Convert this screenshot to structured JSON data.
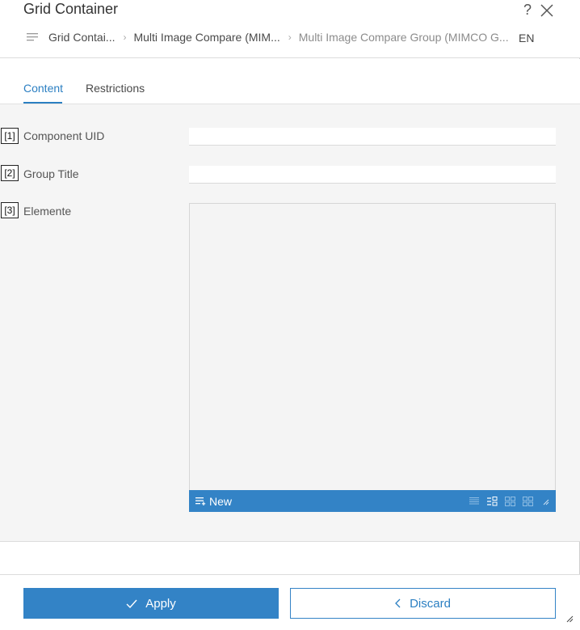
{
  "dialog": {
    "title": "Grid Container",
    "help_glyph": "?",
    "close_icon": "close-icon"
  },
  "breadcrumb": {
    "items": [
      {
        "label": "Grid Contai..."
      },
      {
        "label": "Multi Image Compare (MIM..."
      },
      {
        "label": "Multi Image Compare Group (MIMCO G..."
      }
    ],
    "separator": "›"
  },
  "language": "EN",
  "tabs": [
    {
      "label": "Content",
      "active": true
    },
    {
      "label": "Restrictions",
      "active": false
    }
  ],
  "fields": [
    {
      "index": "[1]",
      "label": "Component UID",
      "value": ""
    },
    {
      "index": "[2]",
      "label": "Group Title",
      "value": ""
    },
    {
      "index": "[3]",
      "label": "Elemente"
    }
  ],
  "multifield": {
    "new_label": "New",
    "view_icons": [
      "list-view-icon",
      "tree-view-icon",
      "grid-view-icon",
      "tiles-view-icon",
      "resize-handle-icon"
    ]
  },
  "footer": {
    "apply_label": "Apply",
    "discard_label": "Discard"
  },
  "colors": {
    "accent": "#3383c6",
    "active_tab": "#2b7fc2",
    "content_bg": "#f5f5f5"
  }
}
